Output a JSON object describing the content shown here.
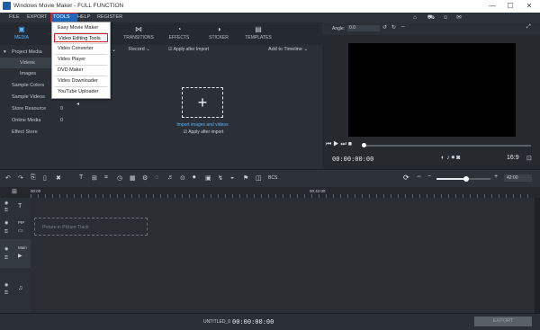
{
  "window": {
    "title": "Windows Movie Maker - FULL FUNCTION",
    "minimize": "—",
    "restore": "☐",
    "close": "✕"
  },
  "menu": {
    "items": [
      "FILE",
      "EXPORT",
      "TOOLS",
      "HELP",
      "REGISTER"
    ],
    "selected": "TOOLS"
  },
  "tools_menu": {
    "items": [
      "Easy Movie Maker",
      "Video Editing Tools",
      "Video Converter",
      "Video Player",
      "DVD Maker",
      "Video Downloader",
      "YouTube Uploader"
    ],
    "highlighted": "Video Editing Tools"
  },
  "media_tabs": [
    {
      "label": "MEDIA",
      "icon": "film-icon",
      "glyph": "▣",
      "active": true
    },
    {
      "label": "TRANSITIONS",
      "icon": "transitions-icon",
      "glyph": "⋈",
      "active": false
    },
    {
      "label": "EFFECTS",
      "icon": "effects-icon",
      "glyph": "◔",
      "active": false
    },
    {
      "label": "STICKER",
      "icon": "sticker-icon",
      "glyph": "◑",
      "active": false
    },
    {
      "label": "TEMPLATES",
      "icon": "templates-icon",
      "glyph": "▤",
      "active": false
    }
  ],
  "sidebar": [
    {
      "label": "Project Media",
      "count": "",
      "active": false
    },
    {
      "label": "Videos",
      "count": "",
      "active": true
    },
    {
      "label": "Images",
      "count": "",
      "active": false
    },
    {
      "label": "Sample Colors",
      "count": "0",
      "active": false
    },
    {
      "label": "Sample Videos",
      "count": "0",
      "active": false
    },
    {
      "label": "Store Resource",
      "count": "0",
      "active": false
    },
    {
      "label": "Online Media",
      "count": "0",
      "active": false
    },
    {
      "label": "Effect Store",
      "count": "",
      "active": false
    }
  ],
  "media_toolbar": {
    "record": "Record",
    "apply_after_import": "Apply after Import",
    "add_to_timeline": "Add to Timeline"
  },
  "import": {
    "plus": "+",
    "label": "Import images and videos",
    "apply_after_import": "Apply after import"
  },
  "preview": {
    "angle_label": "Angle:",
    "angle_value": "0.0",
    "timecode": "00:00:00:00",
    "ratio": "16:9"
  },
  "timeline": {
    "ruler_start": "00:00",
    "ruler_mid": "00:42:00",
    "zoom_value": "42:00",
    "zoom_level": 0.55,
    "pip_track": "Picture in Picture Track",
    "pip_label": "PIP",
    "main_label": "Main",
    "bpm": "BCS"
  },
  "footer": {
    "project": "UNTITLED_0",
    "timecode": "00:00:00:00",
    "export": "EXPORT"
  },
  "colors": {
    "accent": "#58b3ff",
    "menu_selected": "#1e67b8",
    "highlight_border": "#d3222a",
    "preview_bg": "#000000"
  }
}
